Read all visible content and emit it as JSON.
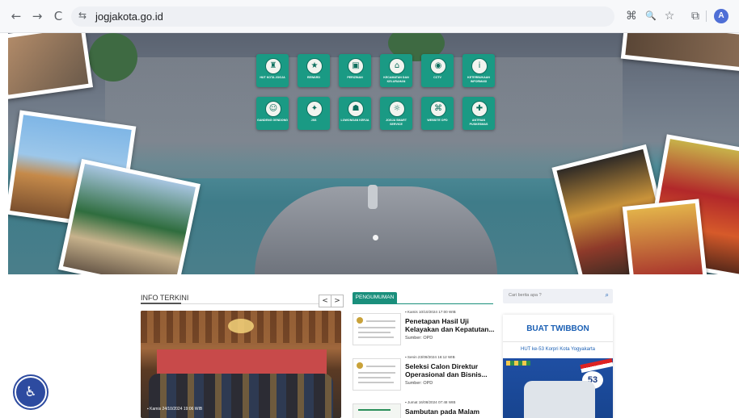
{
  "browser": {
    "url": "jogjakota.go.id",
    "profile_initial": "A",
    "icons": {
      "back": "←",
      "forward": "→",
      "reload": "C",
      "tune": "⇆",
      "translate": "⌘",
      "zoom": "🔍",
      "star": "☆",
      "extensions": "⧉"
    }
  },
  "hero": {
    "apps": [
      {
        "label": "HUT KOTA JOGJA",
        "icon": "crest-icon",
        "glyph": "♜"
      },
      {
        "label": "REWARD",
        "icon": "reward-icon",
        "glyph": "★"
      },
      {
        "label": "PERIZINAN",
        "icon": "permit-icon",
        "glyph": "▣"
      },
      {
        "label": "KECAMATAN DAN KELURAHAN",
        "icon": "district-icon",
        "glyph": "⌂"
      },
      {
        "label": "CCTV",
        "icon": "cctv-icon",
        "glyph": "◉"
      },
      {
        "label": "KETERBUKAAN INFORMASI",
        "icon": "info-icon",
        "glyph": "i"
      },
      {
        "label": "GANDENG GENDONG",
        "icon": "gandeng-icon",
        "glyph": "☺"
      },
      {
        "label": "JSS",
        "icon": "jss-icon",
        "glyph": "✦"
      },
      {
        "label": "LOWONGAN KERJA",
        "icon": "job-icon",
        "glyph": "☗"
      },
      {
        "label": "JOGJA SMART SERVICE",
        "icon": "smart-service-icon",
        "glyph": "☼"
      },
      {
        "label": "WEBSITE OPD",
        "icon": "website-icon",
        "glyph": "⌘"
      },
      {
        "label": "ANTRIAN PUSKESMAS",
        "icon": "clinic-queue-icon",
        "glyph": "✚"
      }
    ]
  },
  "info_terkini": {
    "title": "INFO TERKINI",
    "prev": "<",
    "next": ">",
    "photo_caption": "Kamis 24/10/2024 19:06 WIB"
  },
  "pengumuman": {
    "tab": "PENGUMUMAN",
    "items": [
      {
        "date": "Kamis 10/10/2024 17:00 WIB",
        "title": "Penetapan Hasil Uji Kelayakan dan Kepatutan...",
        "source": "Sumber: OPD"
      },
      {
        "date": "Senin 23/09/2024 16:12 WIB",
        "title": "Seleksi Calon Direktur Operasional dan Bisnis...",
        "source": "Sumber: OPD"
      },
      {
        "date": "Jumat 16/08/2024 07:48 WIB",
        "title": "Sambutan pada Malam",
        "source": ""
      }
    ]
  },
  "sidebar": {
    "search_placeholder": "Cari berita apa ?",
    "twibbon_title": "BUAT TWIBBON",
    "twibbon_subtitle": "HUT ke-53 Korpri Kota Yogyakarta",
    "badge": "53"
  }
}
